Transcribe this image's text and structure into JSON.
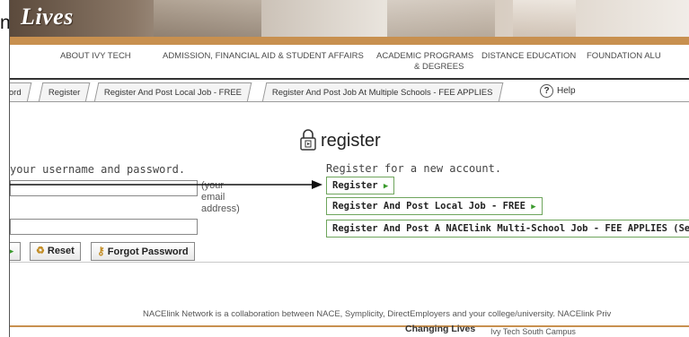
{
  "outer_text": "n.",
  "banner": {
    "title": "Lives"
  },
  "nav": {
    "items": [
      "ABOUT IVY TECH",
      "ADMISSION, FINANCIAL AID & STUDENT AFFAIRS",
      "ACADEMIC PROGRAMS",
      "& DEGREES",
      "DISTANCE EDUCATION",
      "FOUNDATION ALU"
    ]
  },
  "tabs": [
    "ord",
    "Register",
    "Register And Post Local Job - FREE",
    "Register And Post Job At Multiple Schools - FEE APPLIES"
  ],
  "help": {
    "icon": "?",
    "label": "Help"
  },
  "login": {
    "instruction": "your username and password.",
    "username_hint": [
      "(your",
      "email",
      "address)"
    ],
    "reset_label": "Reset",
    "forgot_label": "Forgot Password"
  },
  "register": {
    "title": "register",
    "subtitle": "Register for a new account.",
    "buttons": [
      "Register",
      "Register And Post Local Job - FREE",
      "Register And Post A NACElink Multi-School Job - FEE APPLIES (See A"
    ]
  },
  "footer": {
    "note": "NACElink Network is a collaboration between NACE, Symplicity, DirectEmployers and your college/university. NACElink Priv",
    "brand": "Changing Lives",
    "campus": "Ivy Tech South Campus"
  },
  "colors": {
    "accent": "#c8904f",
    "button_border": "#6ea55c",
    "arrow_green": "#3a9a2c"
  }
}
